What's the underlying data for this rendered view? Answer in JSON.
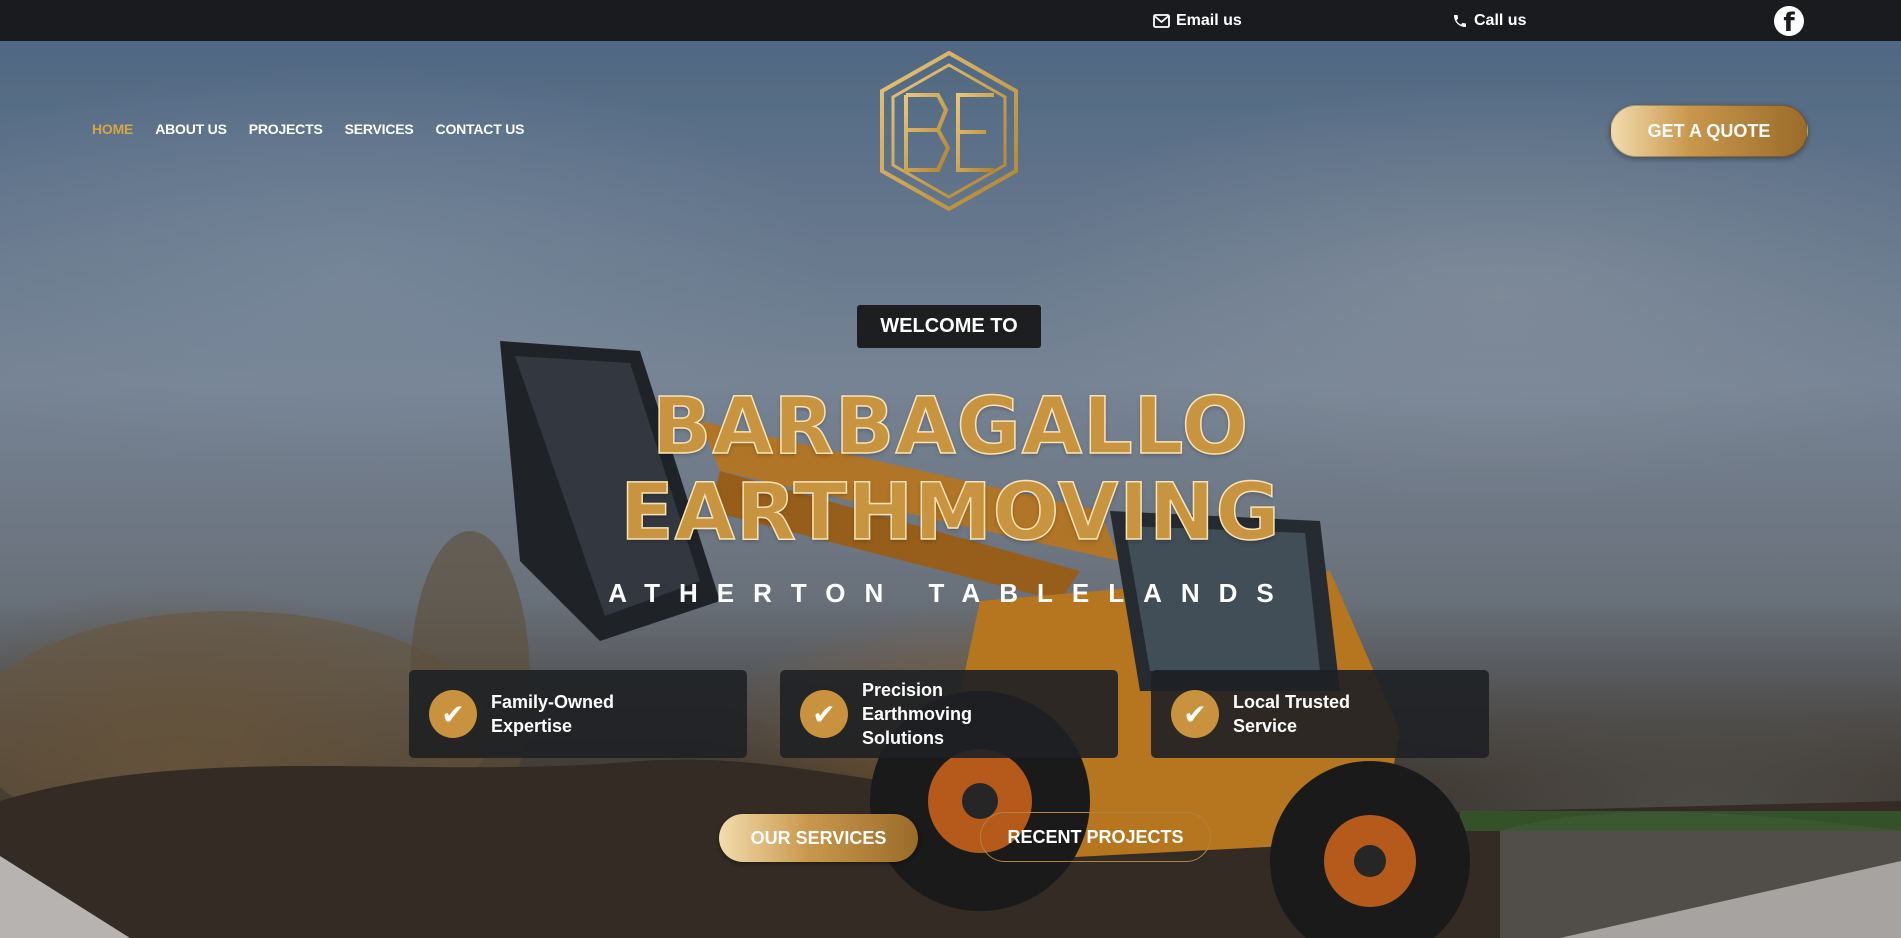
{
  "topbar": {
    "email_label": "Email us",
    "call_label": "Call us",
    "facebook_icon": "facebook-icon"
  },
  "nav": {
    "items": [
      {
        "label": "HOME",
        "active": true
      },
      {
        "label": "ABOUT US",
        "active": false
      },
      {
        "label": "PROJECTS",
        "active": false
      },
      {
        "label": "SERVICES",
        "active": false
      },
      {
        "label": "CONTACT US",
        "active": false
      }
    ]
  },
  "header": {
    "cta_label": "GET A QUOTE"
  },
  "hero": {
    "welcome": "WELCOME TO",
    "title_line1": "BARBAGALLO",
    "title_line2": "EARTHMOVING",
    "subtitle": "ATHERTON TABLELANDS",
    "features": [
      {
        "line1": "Family-Owned",
        "line2": "Expertise"
      },
      {
        "line1": "Precision Earthmoving",
        "line2": "Solutions"
      },
      {
        "line1": "Local Trusted",
        "line2": "Service"
      }
    ],
    "primary_button": "OUR SERVICES",
    "secondary_button": "RECENT PROJECTS"
  },
  "colors": {
    "gold": "#c9943f",
    "active_nav": "#d8a44a",
    "topbar_bg": "#1a1b1e"
  }
}
